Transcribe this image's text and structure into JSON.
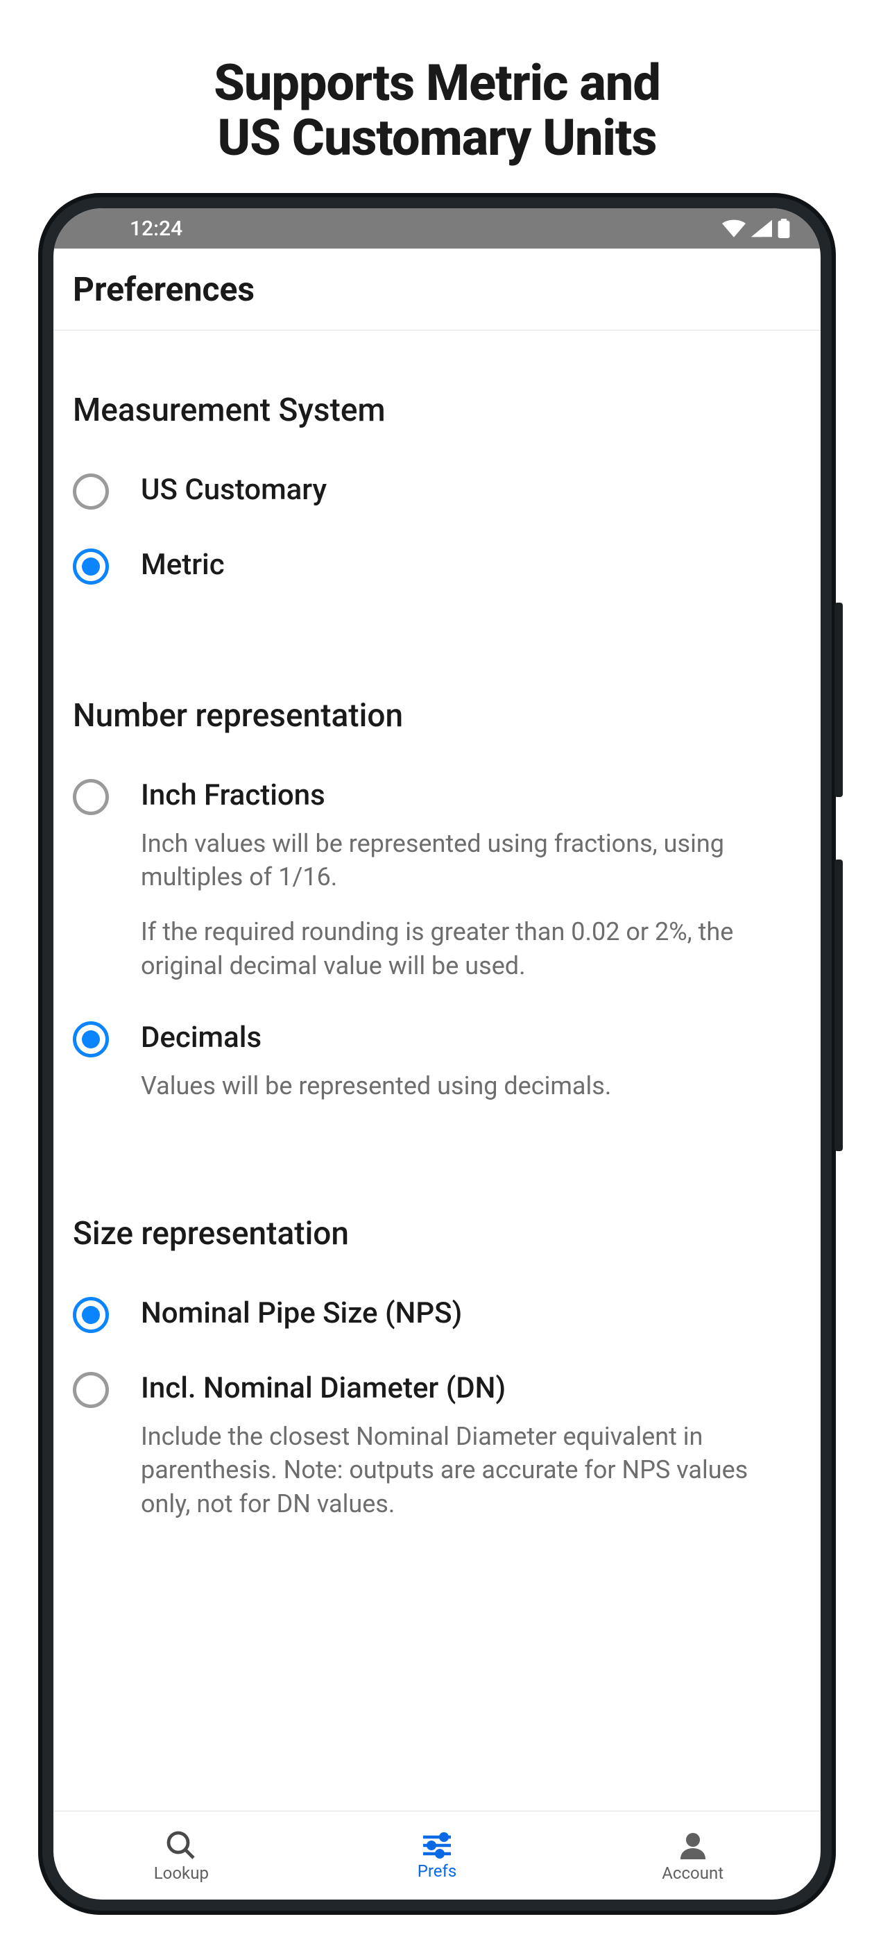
{
  "headline": {
    "line1": "Supports Metric and",
    "line2": "US Customary Units"
  },
  "statusbar": {
    "time": "12:24"
  },
  "header": {
    "title": "Preferences"
  },
  "sections": {
    "measurement": {
      "title": "Measurement System",
      "options": {
        "us": {
          "label": "US Customary",
          "selected": false
        },
        "metric": {
          "label": "Metric",
          "selected": true
        }
      }
    },
    "number": {
      "title": "Number representation",
      "options": {
        "fractions": {
          "label": "Inch Fractions",
          "desc1": "Inch values will be represented using fractions, using multiples of 1/16.",
          "desc2": "If the required rounding is greater than 0.02 or 2%, the original decimal value will be used.",
          "selected": false
        },
        "decimals": {
          "label": "Decimals",
          "desc1": "Values will be represented using decimals.",
          "selected": true
        }
      }
    },
    "size": {
      "title": "Size representation",
      "options": {
        "nps": {
          "label": "Nominal Pipe Size (NPS)",
          "selected": true
        },
        "dn": {
          "label": "Incl. Nominal Diameter (DN)",
          "desc1": "Include the closest Nominal Diameter equivalent in parenthesis. Note: outputs are accurate for NPS values only, not for DN values.",
          "selected": false
        }
      }
    }
  },
  "nav": {
    "lookup": "Lookup",
    "prefs": "Prefs",
    "account": "Account"
  },
  "colors": {
    "accent": "#0a84ff",
    "statusbar": "#7c7c7c",
    "text_secondary": "#6d6d6d"
  }
}
